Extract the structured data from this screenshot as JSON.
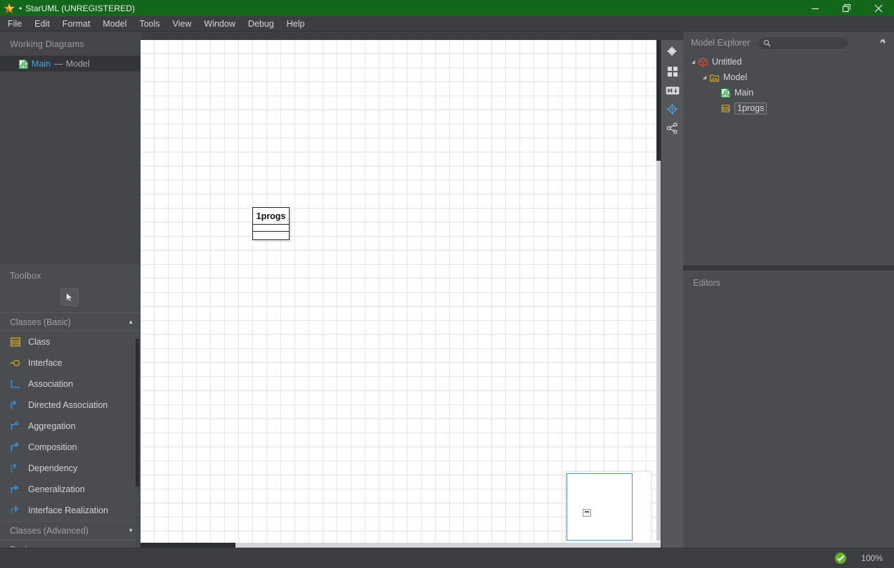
{
  "window": {
    "title": "StarUML (UNREGISTERED)",
    "dirty_marker": "•",
    "logo_icon": "star-icon",
    "controls": {
      "minimize": "minimize-icon",
      "restore": "restore-icon",
      "close": "close-icon"
    }
  },
  "menubar": {
    "items": [
      {
        "label": "File"
      },
      {
        "label": "Edit"
      },
      {
        "label": "Format"
      },
      {
        "label": "Model"
      },
      {
        "label": "Tools"
      },
      {
        "label": "View"
      },
      {
        "label": "Window"
      },
      {
        "label": "Debug"
      },
      {
        "label": "Help"
      }
    ]
  },
  "working_diagrams": {
    "title": "Working Diagrams",
    "items": [
      {
        "name": "Main",
        "separator": "—",
        "type": "Model",
        "icon": "class-diagram-icon",
        "selected": true
      }
    ]
  },
  "toolbox": {
    "title": "Toolbox",
    "select_tool": {
      "name": "select-tool",
      "icon": "cursor-arrow-icon"
    },
    "sections": [
      {
        "label": "Classes (Basic)",
        "expanded": true,
        "caret": "▲",
        "items": [
          {
            "label": "Class",
            "icon": "class-icon"
          },
          {
            "label": "Interface",
            "icon": "interface-icon"
          },
          {
            "label": "Association",
            "icon": "association-icon"
          },
          {
            "label": "Directed Association",
            "icon": "directed-association-icon"
          },
          {
            "label": "Aggregation",
            "icon": "aggregation-icon"
          },
          {
            "label": "Composition",
            "icon": "composition-icon"
          },
          {
            "label": "Dependency",
            "icon": "dependency-icon"
          },
          {
            "label": "Generalization",
            "icon": "generalization-icon"
          },
          {
            "label": "Interface Realization",
            "icon": "interface-realization-icon"
          }
        ]
      },
      {
        "label": "Classes (Advanced)",
        "expanded": false,
        "caret": "▼",
        "items": []
      },
      {
        "label": "Packages",
        "expanded": false,
        "caret": "▼",
        "items": []
      }
    ]
  },
  "canvas": {
    "diagram_name": "Main",
    "nodes": [
      {
        "name": "1progs",
        "type": "class",
        "compartments": 2
      }
    ],
    "minimap": {
      "name": "diagram-minimap"
    }
  },
  "rail": {
    "buttons": [
      {
        "name": "extension-manager-button",
        "icon": "puzzle-icon",
        "active": false
      },
      {
        "name": "panels-button",
        "icon": "grid-squares-icon",
        "active": false
      },
      {
        "name": "markdown-button",
        "icon": "markdown-icon",
        "active": false
      },
      {
        "name": "minimap-button",
        "icon": "crosshair-target-icon",
        "active": true
      },
      {
        "name": "share-button",
        "icon": "share-network-icon",
        "active": false
      }
    ]
  },
  "model_explorer": {
    "title": "Model Explorer",
    "search": {
      "value": "",
      "placeholder": "",
      "icon": "search-icon"
    },
    "settings_icon": "gear-icon",
    "tree": [
      {
        "label": "Untitled",
        "icon": "project-cube-icon",
        "caret": "◢",
        "depth": 0,
        "selected": false
      },
      {
        "label": "Model",
        "icon": "package-icon",
        "caret": "◢",
        "depth": 1,
        "selected": false
      },
      {
        "label": "Main",
        "icon": "class-diagram-icon",
        "caret": "",
        "depth": 2,
        "selected": false
      },
      {
        "label": "1progs",
        "icon": "class-icon",
        "caret": "",
        "depth": 2,
        "selected": true
      }
    ]
  },
  "editors": {
    "title": "Editors"
  },
  "statusbar": {
    "validation_icon": "check-circle-icon",
    "zoom": "100%"
  },
  "colors": {
    "titlebar": "#13671a",
    "accent_blue": "#4da3d8",
    "icon_gold": "#c9a227",
    "icon_green": "#2f9e44",
    "icon_red": "#d94c3d",
    "status_green": "#62b22e"
  }
}
